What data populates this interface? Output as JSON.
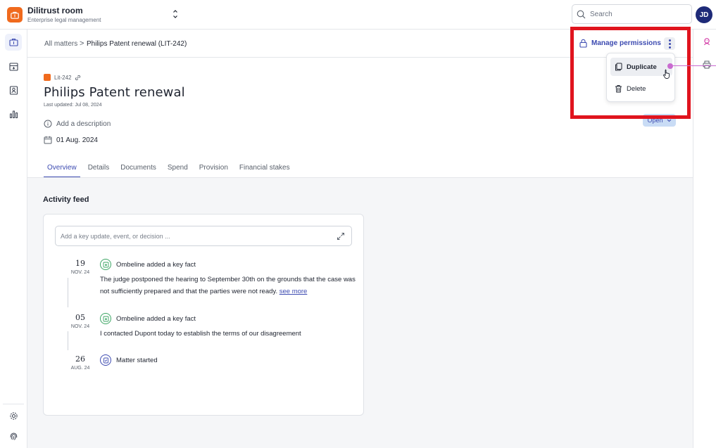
{
  "app": {
    "title": "Dilitrust room",
    "subtitle": "Enterprise legal management",
    "brand_color": "#f06a1d",
    "accent_color": "#3d4bb1"
  },
  "topbar": {
    "search_placeholder": "Search",
    "avatar_initials": "JD"
  },
  "breadcrumb": {
    "root": "All matters",
    "separator": ">",
    "current": "Philips Patent renewal (LIT-242)"
  },
  "actions": {
    "manage_permissions": "Manage permissions"
  },
  "menu": {
    "items": [
      {
        "label": "Duplicate",
        "icon": "copy-icon",
        "hovered": true
      },
      {
        "label": "Delete",
        "icon": "trash-icon",
        "hovered": false
      }
    ]
  },
  "matter": {
    "ref_id": "Lit-242",
    "title": "Philips Patent renewal",
    "last_updated": "Last updated: Jul 08, 2024",
    "description_prompt": "Add a description",
    "date": "01 Aug. 2024",
    "status": "Open"
  },
  "tabs": [
    {
      "label": "Overview",
      "active": true
    },
    {
      "label": "Details",
      "active": false
    },
    {
      "label": "Documents",
      "active": false
    },
    {
      "label": "Spend",
      "active": false
    },
    {
      "label": "Provision",
      "active": false
    },
    {
      "label": "Financial stakes",
      "active": false
    }
  ],
  "activity": {
    "title": "Activity feed",
    "input_placeholder": "Add a key update, event, or decision ...",
    "entries": [
      {
        "day": "19",
        "month": "NOV. 24",
        "author_line": "Ombeline added a key fact",
        "text": "The judge postponed the hearing to September 30th on the grounds that the case was not sufficiently prepared and that the parties were not ready.",
        "link": "see more"
      },
      {
        "day": "05",
        "month": "NOV. 24",
        "author_line": "Ombeline added a key fact",
        "text": "I contacted Dupont today to establish the terms of our disagreement"
      },
      {
        "day": "26",
        "month": "AUG. 24",
        "author_line": "Matter started"
      }
    ]
  }
}
